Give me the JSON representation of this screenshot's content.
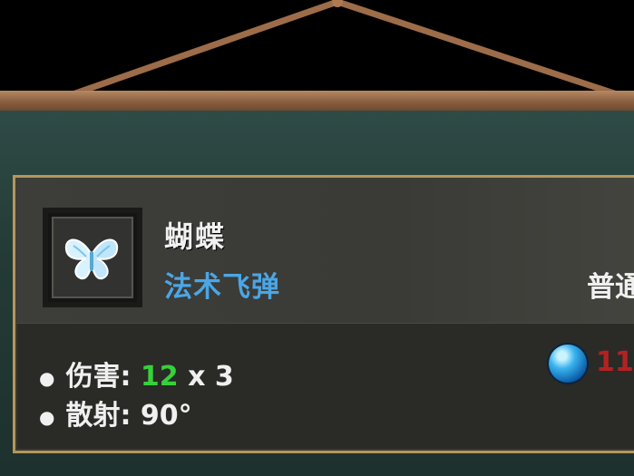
{
  "item": {
    "name": "蝴蝶",
    "type": "法术飞弹",
    "rarity": "普通",
    "icon": "butterfly-icon"
  },
  "stats": {
    "damage_label": "伤害:",
    "damage_value": "12",
    "damage_multiplier": "x 3",
    "spread_label": "散射:",
    "spread_value": "90°"
  },
  "mana": {
    "icon": "blue-orb-icon",
    "cost": "11"
  },
  "colors": {
    "name": "#f1f1f1",
    "type": "#4aa6e6",
    "damage_value": "#35d13b",
    "mana_cost": "#b22222",
    "frame_gold": "#b4975a",
    "board": "#233b37"
  }
}
